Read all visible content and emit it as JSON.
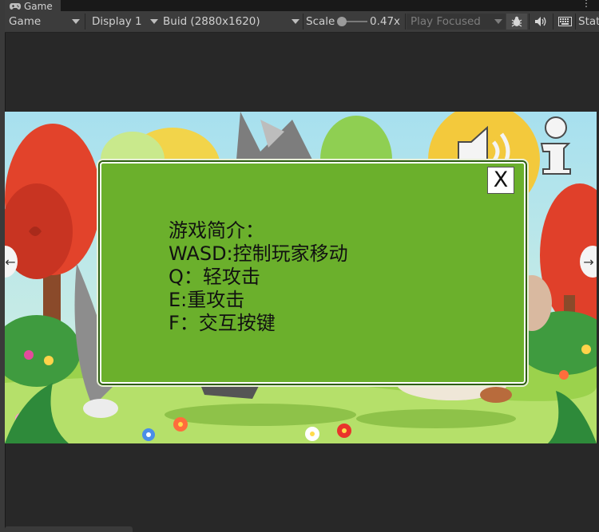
{
  "window": {
    "tab_label": "Game",
    "tab_icon": "gamepad-icon",
    "more_label": "⋮"
  },
  "toolbar": {
    "view_mode": "Game",
    "display": "Display 1",
    "resolution": "Buid (2880x1620)",
    "scale_label": "Scale",
    "scale_value": "0.47x",
    "play_mode": "Play Focused",
    "stats_label": "Stat",
    "icons": [
      "bug-icon",
      "speaker-icon",
      "keyboard-icon"
    ]
  },
  "dialog": {
    "close_label": "X",
    "lines": [
      "游戏简介：",
      "WASD:控制玩家移动",
      "Q：轻攻击",
      "E:重攻击",
      "F：交互按键"
    ]
  },
  "game": {
    "left_arrow": "←",
    "right_arrow": "→",
    "info_label": "i",
    "icons": [
      "speaker-icon",
      "info-icon"
    ]
  },
  "colors": {
    "dialog_bg": "#6bb02c",
    "editor_bg": "#282828",
    "toolbar_bg": "#3c3c3c"
  }
}
